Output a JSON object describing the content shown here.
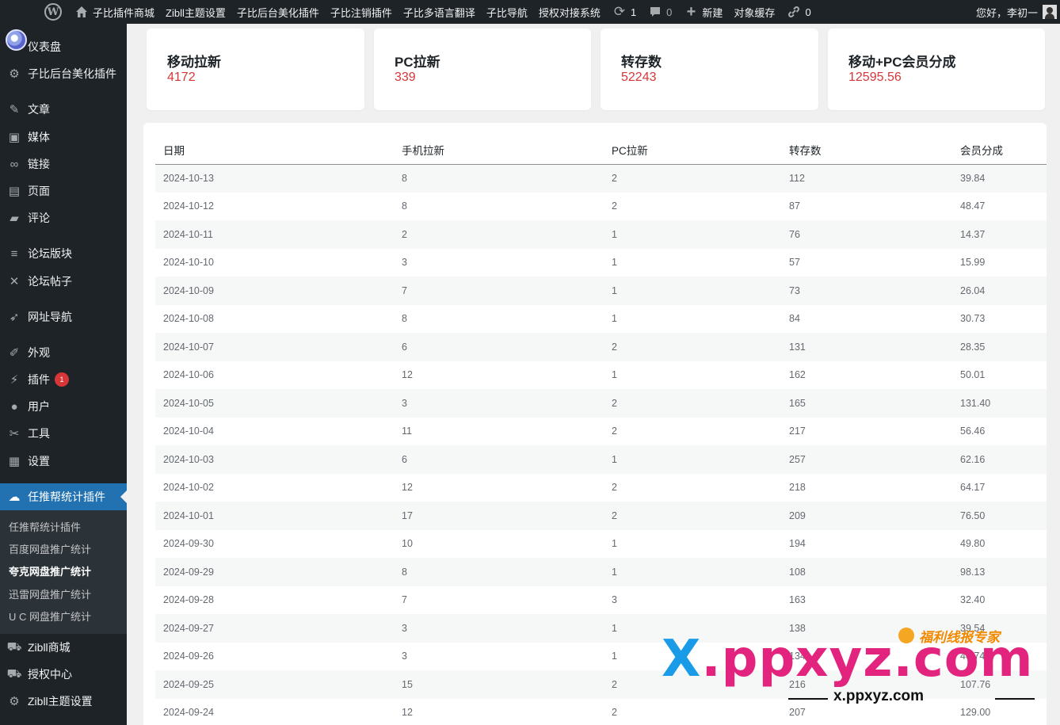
{
  "adminbar": {
    "items": [
      "子比插件商城",
      "Zibll主题设置",
      "子比后台美化插件",
      "子比注销插件",
      "子比多语言翻译",
      "子比导航",
      "授权对接系统"
    ],
    "updates_count": "1",
    "comments_count": "0",
    "new_label": "新建",
    "cache_label": "对象缓存",
    "links_count": "0",
    "greeting": "您好，李初一"
  },
  "sidebar": {
    "items": [
      {
        "label": "仪表盘",
        "icon": "dashboard-icon"
      },
      {
        "label": "子比后台美化插件",
        "icon": "gear-icon"
      },
      {
        "label": "文章",
        "icon": "pin-icon"
      },
      {
        "label": "媒体",
        "icon": "media-icon"
      },
      {
        "label": "链接",
        "icon": "link-icon"
      },
      {
        "label": "页面",
        "icon": "page-icon"
      },
      {
        "label": "评论",
        "icon": "comment-icon"
      },
      {
        "label": "论坛版块",
        "icon": "forum-icon"
      },
      {
        "label": "论坛帖子",
        "icon": "post-icon"
      },
      {
        "label": "网址导航",
        "icon": "rocket-icon"
      },
      {
        "label": "外观",
        "icon": "brush-icon"
      },
      {
        "label": "插件",
        "icon": "plugin-icon",
        "badge": "1"
      },
      {
        "label": "用户",
        "icon": "user-icon"
      },
      {
        "label": "工具",
        "icon": "wrench-icon"
      },
      {
        "label": "设置",
        "icon": "settings-icon"
      },
      {
        "label": "任推帮统计插件",
        "icon": "cloud-icon"
      },
      {
        "label": "Zibll商城",
        "icon": "cart-icon"
      },
      {
        "label": "授权中心",
        "icon": "cart-icon"
      },
      {
        "label": "Zibll主题设置",
        "icon": "gear-icon"
      }
    ],
    "submenu": [
      "任推帮统计插件",
      "百度网盘推广统计",
      "夸克网盘推广统计",
      "迅雷网盘推广统计",
      "U C 网盘推广统计"
    ]
  },
  "cards": [
    {
      "label": "移动拉新",
      "value": "4172"
    },
    {
      "label": "PC拉新",
      "value": "339"
    },
    {
      "label": "转存数",
      "value": "52243"
    },
    {
      "label": "移动+PC会员分成",
      "value": "12595.56"
    }
  ],
  "table": {
    "headers": [
      "日期",
      "手机拉新",
      "PC拉新",
      "转存数",
      "会员分成"
    ],
    "rows": [
      [
        "2024-10-13",
        "8",
        "2",
        "112",
        "39.84"
      ],
      [
        "2024-10-12",
        "8",
        "2",
        "87",
        "48.47"
      ],
      [
        "2024-10-11",
        "2",
        "1",
        "76",
        "14.37"
      ],
      [
        "2024-10-10",
        "3",
        "1",
        "57",
        "15.99"
      ],
      [
        "2024-10-09",
        "7",
        "1",
        "73",
        "26.04"
      ],
      [
        "2024-10-08",
        "8",
        "1",
        "84",
        "30.73"
      ],
      [
        "2024-10-07",
        "6",
        "2",
        "131",
        "28.35"
      ],
      [
        "2024-10-06",
        "12",
        "1",
        "162",
        "50.01"
      ],
      [
        "2024-10-05",
        "3",
        "2",
        "165",
        "131.40"
      ],
      [
        "2024-10-04",
        "11",
        "2",
        "217",
        "56.46"
      ],
      [
        "2024-10-03",
        "6",
        "1",
        "257",
        "62.16"
      ],
      [
        "2024-10-02",
        "12",
        "2",
        "218",
        "64.17"
      ],
      [
        "2024-10-01",
        "17",
        "2",
        "209",
        "76.50"
      ],
      [
        "2024-09-30",
        "10",
        "1",
        "194",
        "49.80"
      ],
      [
        "2024-09-29",
        "8",
        "1",
        "108",
        "98.13"
      ],
      [
        "2024-09-28",
        "7",
        "3",
        "163",
        "32.40"
      ],
      [
        "2024-09-27",
        "3",
        "1",
        "138",
        "39.54"
      ],
      [
        "2024-09-26",
        "3",
        "1",
        "134",
        "40.74"
      ],
      [
        "2024-09-25",
        "15",
        "2",
        "216",
        "107.76"
      ],
      [
        "2024-09-24",
        "12",
        "2",
        "207",
        "129.00"
      ]
    ]
  },
  "watermark": {
    "tag": "福利线报专家",
    "big": "X.ppxyz.com",
    "small": "x.ppxyz.com"
  },
  "colors": {
    "accent": "#2271b1",
    "value_red": "#d63638",
    "dark": "#1d2327"
  }
}
